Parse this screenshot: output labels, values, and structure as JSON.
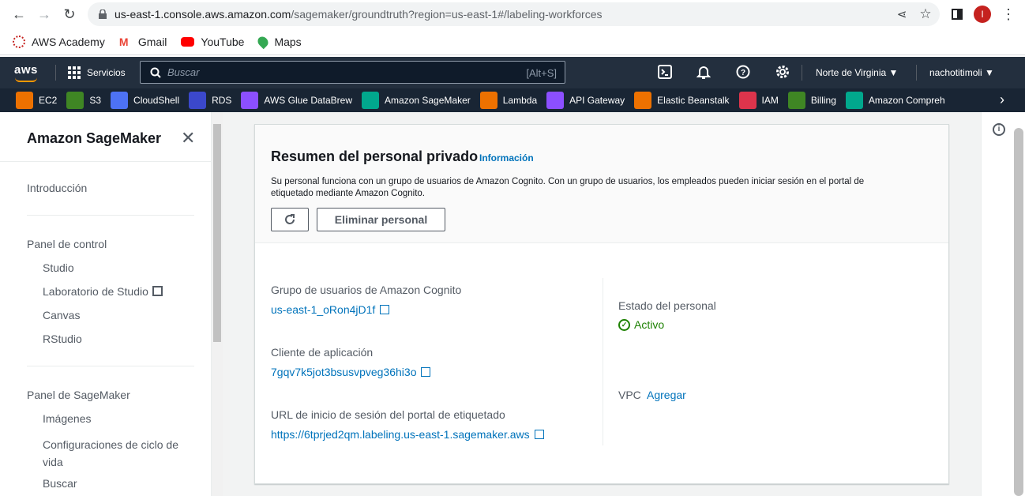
{
  "browser": {
    "url_host": "us-east-1.console.aws.amazon.com",
    "url_path": "/sagemaker/groundtruth?region=us-east-1#/labeling-workforces",
    "profile_initial": "I",
    "bookmarks": [
      "AWS Academy",
      "Gmail",
      "YouTube",
      "Maps"
    ]
  },
  "aws_header": {
    "logo": "aws",
    "services_label": "Servicios",
    "search_placeholder": "Buscar",
    "search_shortcut": "[Alt+S]",
    "region": "Norte de Virginia ▼",
    "user": "nachotitimoli ▼"
  },
  "favorites": [
    {
      "label": "EC2",
      "color": "#ed7100"
    },
    {
      "label": "S3",
      "color": "#3f8624"
    },
    {
      "label": "CloudShell",
      "color": "#4d72f3"
    },
    {
      "label": "RDS",
      "color": "#3b48cc"
    },
    {
      "label": "AWS Glue DataBrew",
      "color": "#8c4fff"
    },
    {
      "label": "Amazon SageMaker",
      "color": "#01a88d"
    },
    {
      "label": "Lambda",
      "color": "#ed7100"
    },
    {
      "label": "API Gateway",
      "color": "#8c4fff"
    },
    {
      "label": "Elastic Beanstalk",
      "color": "#ed7100"
    },
    {
      "label": "IAM",
      "color": "#dd344c"
    },
    {
      "label": "Billing",
      "color": "#3f8624"
    },
    {
      "label": "Amazon Compreh",
      "color": "#01a88d"
    }
  ],
  "sidebar": {
    "title": "Amazon SageMaker",
    "intro": "Introducción",
    "panel_control": "Panel de control",
    "studio": "Studio",
    "studio_lab": "Laboratorio de Studio",
    "canvas": "Canvas",
    "rstudio": "RStudio",
    "panel_sagemaker": "Panel de SageMaker",
    "images": "Imágenes",
    "lifecycle_line1": "Configuraciones de ciclo de",
    "lifecycle_line2": "vida",
    "search": "Buscar"
  },
  "card": {
    "title": "Resumen del personal privado",
    "info": "Información",
    "desc_line1": "Su personal funciona con un grupo de usuarios de Amazon Cognito. Con un grupo de usuarios, los empleados pueden iniciar sesión en el portal de",
    "desc_line2": "etiquetado mediante Amazon Cognito.",
    "delete_btn": "Eliminar personal",
    "user_pool_label": "Grupo de usuarios de Amazon Cognito",
    "user_pool_value": "us-east-1_oRon4jD1f",
    "app_client_label": "Cliente de aplicación",
    "app_client_value": "7gqv7k5jot3bsusvpveg36hi3o",
    "login_url_label": "URL de inicio de sesión del portal de etiquetado",
    "login_url_value": "https://6tprjed2qm.labeling.us-east-1.sagemaker.aws",
    "status_label": "Estado del personal",
    "status_value": "Activo",
    "vpc_label": "VPC",
    "vpc_value": "Agregar"
  }
}
